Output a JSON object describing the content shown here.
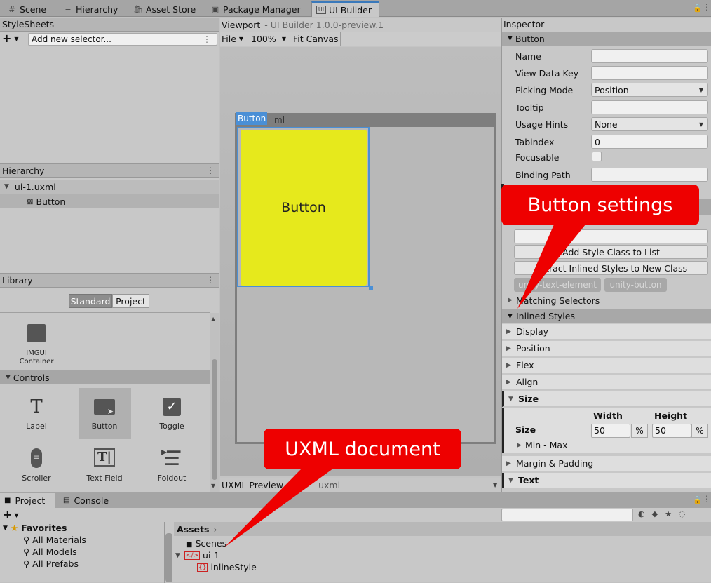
{
  "tabs": [
    {
      "icon": "#",
      "label": "Scene"
    },
    {
      "icon": "≡",
      "label": "Hierarchy"
    },
    {
      "icon": "🛍",
      "label": "Asset Store"
    },
    {
      "icon": "▣",
      "label": "Package Manager"
    },
    {
      "icon": "UI",
      "label": "UI Builder"
    }
  ],
  "stylesheets": {
    "title": "StyleSheets",
    "add": "+",
    "selector_placeholder": "Add new selector..."
  },
  "hierarchy": {
    "title": "Hierarchy",
    "root": "ui-1.uxml",
    "child": "Button"
  },
  "library": {
    "title": "Library",
    "tab_standard": "Standard",
    "tab_project": "Project",
    "imgui": "IMGUI Container",
    "controls_header": "Controls",
    "items": [
      "Label",
      "Button",
      "Toggle",
      "Scroller",
      "Text Field",
      "Foldout"
    ]
  },
  "viewport": {
    "title": "Viewport",
    "subtitle": "UI Builder 1.0.0-preview.1",
    "file_menu": "File",
    "zoom": "100%",
    "fit": "Fit Canvas",
    "canvas_tag": "Button",
    "canvas_suffix": "ml",
    "button_text": "Button",
    "uxml_preview": "UXML Preview",
    "uxml_suffix": "uxml",
    "button_color": "#e6e91c"
  },
  "inspector": {
    "title": "Inspector",
    "section": "Button",
    "fields": [
      {
        "label": "Name",
        "value": ""
      },
      {
        "label": "View Data Key",
        "value": ""
      },
      {
        "label": "Picking Mode",
        "value": "Position"
      },
      {
        "label": "Tooltip",
        "value": ""
      },
      {
        "label": "Usage Hints",
        "value": "None"
      },
      {
        "label": "Tabindex",
        "value": "0"
      },
      {
        "label": "Focusable",
        "value": ""
      },
      {
        "label": "Binding Path",
        "value": ""
      }
    ],
    "add_style_class": "Add Style Class to List",
    "extract_styles": "Extract Inlined Styles to New Class",
    "class_tags": [
      "unity-text-element",
      "unity-button"
    ],
    "matching": "Matching Selectors",
    "inlined": "Inlined Styles",
    "folds": [
      "Display",
      "Position",
      "Flex",
      "Align"
    ],
    "size": "Size",
    "width_label": "Width",
    "height_label": "Height",
    "width_value": "50",
    "height_value": "50",
    "unit": "%",
    "minmax": "Min - Max",
    "margin": "Margin & Padding",
    "text": "Text"
  },
  "project": {
    "tab_project": "Project",
    "tab_console": "Console",
    "favorites": "Favorites",
    "fav_items": [
      "All Materials",
      "All Models",
      "All Prefabs"
    ],
    "assets": "Assets",
    "tree": [
      "Scenes",
      "ui-1",
      "inlineStyle"
    ]
  },
  "callouts": {
    "settings": "Button settings",
    "uxml": "UXML document",
    "color": "#ee0000"
  }
}
